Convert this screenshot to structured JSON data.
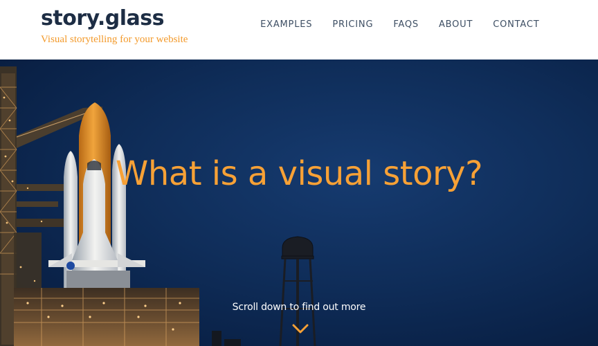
{
  "brand": {
    "title": "story.glass",
    "tagline": "Visual storytelling for your website"
  },
  "nav": {
    "items": [
      {
        "label": "EXAMPLES"
      },
      {
        "label": "PRICING"
      },
      {
        "label": "FAQS"
      },
      {
        "label": "ABOUT"
      },
      {
        "label": "CONTACT"
      }
    ]
  },
  "hero": {
    "heading": "What is a visual story?",
    "scroll_text": "Scroll down to find out more",
    "scroll_icon": "chevron-down-icon",
    "image": "space-shuttle-launchpad-photo"
  },
  "colors": {
    "accent": "#f7a136",
    "brand_text": "#1d2d44",
    "tagline": "#f39a2b",
    "nav_text": "#3d4e63",
    "hero_bg": "#0f2d59"
  }
}
